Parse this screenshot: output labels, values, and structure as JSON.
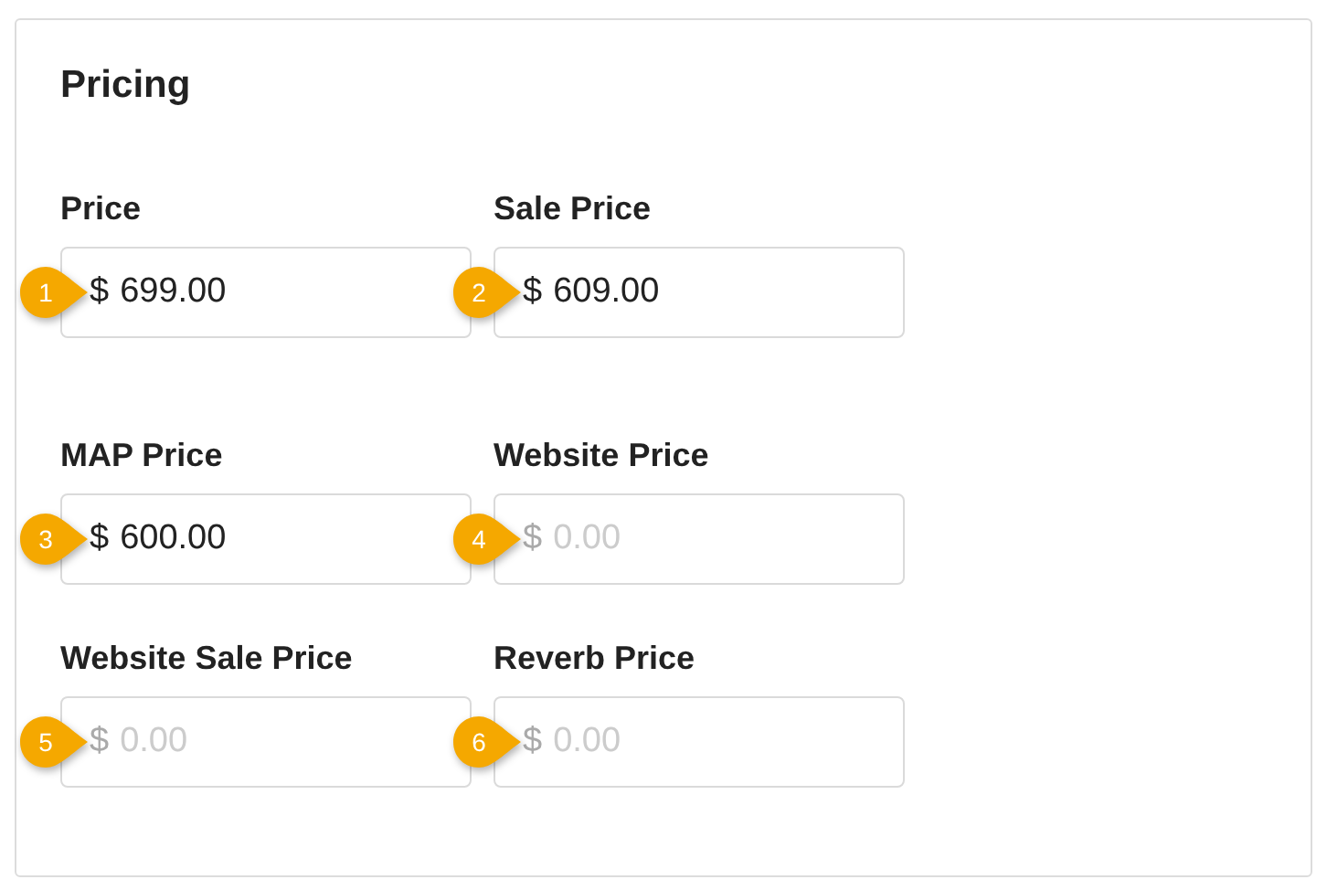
{
  "panel": {
    "title": "Pricing"
  },
  "rows": [
    {
      "fields": [
        {
          "label": "Price",
          "prefix": "$",
          "value": "699.00",
          "badge": "1"
        },
        {
          "label": "Sale Price",
          "prefix": "$",
          "value": "609.00",
          "badge": "2"
        }
      ]
    },
    {
      "fields": [
        {
          "label": "MAP Price",
          "prefix": "$",
          "value": "600.00",
          "badge": "3"
        },
        {
          "label": "Website Price",
          "prefix": "$",
          "placeholder": "0.00",
          "badge": "4"
        }
      ]
    },
    {
      "fields": [
        {
          "label": "Website Sale Price",
          "prefix": "$",
          "placeholder": "0.00",
          "badge": "5"
        },
        {
          "label": "Reverb Price",
          "prefix": "$",
          "placeholder": "0.00",
          "badge": "6"
        }
      ]
    }
  ]
}
